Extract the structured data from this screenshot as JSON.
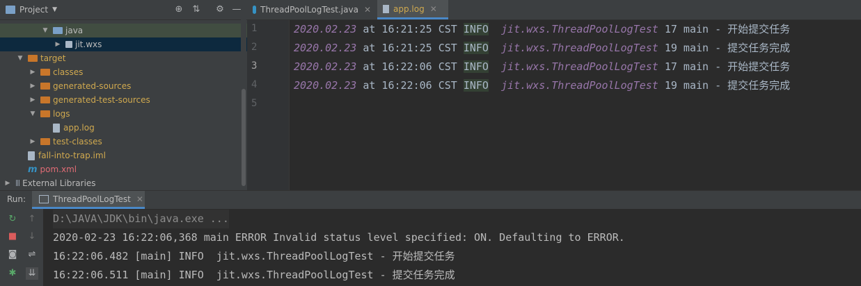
{
  "project": {
    "title": "Project",
    "tree": [
      {
        "label": "java",
        "indent": 3,
        "arrow": "▼",
        "icon": "folder-blue",
        "color": "#bbbbbb"
      },
      {
        "label": "jit.wxs",
        "indent": 4,
        "arrow": "▶",
        "icon": "package",
        "color": "#bbbbbb"
      },
      {
        "label": "target",
        "indent": 1,
        "arrow": "▼",
        "icon": "folder-orange",
        "color": "#d0a94f"
      },
      {
        "label": "classes",
        "indent": 2,
        "arrow": "▶",
        "icon": "folder-orange",
        "color": "#d0a94f"
      },
      {
        "label": "generated-sources",
        "indent": 2,
        "arrow": "▶",
        "icon": "folder-orange",
        "color": "#d0a94f"
      },
      {
        "label": "generated-test-sources",
        "indent": 2,
        "arrow": "▶",
        "icon": "folder-orange",
        "color": "#d0a94f"
      },
      {
        "label": "logs",
        "indent": 2,
        "arrow": "▼",
        "icon": "folder-orange",
        "color": "#d0a94f"
      },
      {
        "label": "app.log",
        "indent": 3,
        "arrow": "",
        "icon": "file",
        "color": "#d0a94f"
      },
      {
        "label": "test-classes",
        "indent": 2,
        "arrow": "▶",
        "icon": "folder-orange",
        "color": "#d0a94f"
      },
      {
        "label": "fall-into-trap.iml",
        "indent": 1,
        "arrow": "",
        "icon": "file",
        "color": "#d0a94f"
      },
      {
        "label": "pom.xml",
        "indent": 1,
        "arrow": "",
        "icon": "maven",
        "color": "#e06c75"
      },
      {
        "label": "External Libraries",
        "indent": 0,
        "arrow": "▶",
        "icon": "libraries",
        "color": "#bbbbbb"
      }
    ]
  },
  "editor": {
    "tabs": [
      {
        "label": "ThreadPoolLogTest.java",
        "active": false
      },
      {
        "label": "app.log",
        "active": true
      }
    ],
    "line_numbers": [
      "1",
      "2",
      "3",
      "4",
      "5"
    ],
    "lines": [
      {
        "date": "2020.02.23",
        "at": " at 16:21:25 CST ",
        "level": "INFO",
        "cls": "jit.wxs.ThreadPoolLogTest",
        "rest": " 17 main - 开始提交任务"
      },
      {
        "date": "2020.02.23",
        "at": " at 16:21:25 CST ",
        "level": "INFO",
        "cls": "jit.wxs.ThreadPoolLogTest",
        "rest": " 19 main - 提交任务完成"
      },
      {
        "date": "2020.02.23",
        "at": " at 16:22:06 CST ",
        "level": "INFO",
        "cls": "jit.wxs.ThreadPoolLogTest",
        "rest": " 17 main - 开始提交任务"
      },
      {
        "date": "2020.02.23",
        "at": " at 16:22:06 CST ",
        "level": "INFO",
        "cls": "jit.wxs.ThreadPoolLogTest",
        "rest": " 19 main - 提交任务完成"
      }
    ]
  },
  "run": {
    "label": "Run:",
    "tab": "ThreadPoolLogTest",
    "console": [
      "D:\\JAVA\\JDK\\bin\\java.exe ...",
      "2020-02-23 16:22:06,368 main ERROR Invalid status level specified: ON. Defaulting to ERROR.",
      "16:22:06.482 [main] INFO  jit.wxs.ThreadPoolLogTest - 开始提交任务",
      "16:22:06.511 [main] INFO  jit.wxs.ThreadPoolLogTest - 提交任务完成"
    ]
  }
}
